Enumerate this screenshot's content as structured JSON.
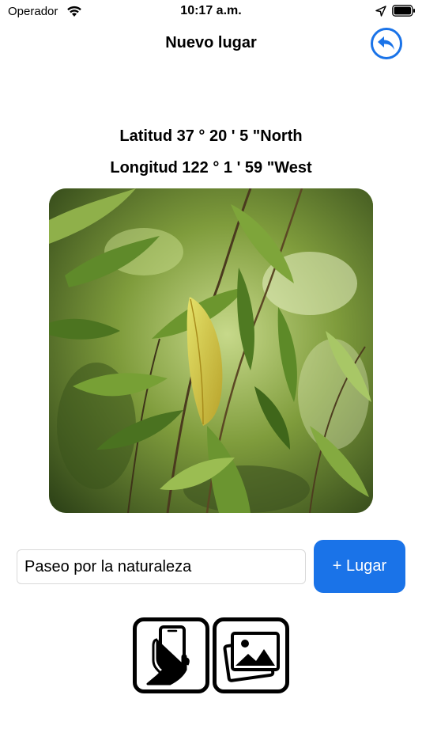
{
  "status_bar": {
    "carrier": "Operador",
    "time": "10:17 a.m.",
    "icons": [
      "wifi-icon",
      "location-arrow-icon",
      "battery-icon"
    ]
  },
  "nav": {
    "title": "Nuevo lugar",
    "back_icon": "undo-arrow-icon"
  },
  "coordinates": {
    "latitude": "Latitud 37 ° 20 ' 5 \"North",
    "longitude": "Longitud 122 ° 1 ' 59 \"West"
  },
  "photo": {
    "subject": "green leaves with one yellow leaf"
  },
  "form": {
    "name_value": "Paseo por la naturaleza",
    "add_button_label": "+ Lugar"
  },
  "actions": {
    "camera_icon": "phone-in-hand-icon",
    "gallery_icon": "photo-gallery-icon"
  },
  "colors": {
    "accent": "#1a73e8",
    "background": "#ffffff"
  }
}
